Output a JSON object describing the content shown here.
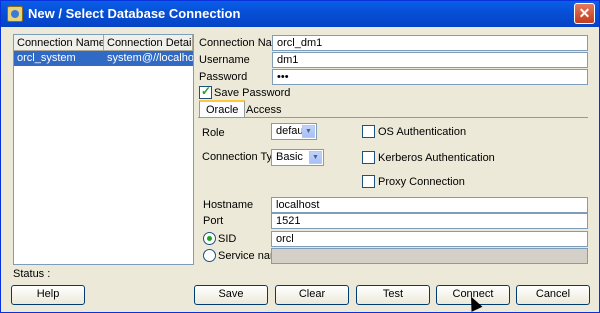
{
  "window": {
    "title": "New / Select Database Connection",
    "close_label": "✕"
  },
  "connections": {
    "columns": [
      "Connection Name",
      "Connection Details"
    ],
    "rows": [
      {
        "name": "orcl_system",
        "details": "system@//localhost..."
      }
    ]
  },
  "status": {
    "label": "Status :"
  },
  "form": {
    "connection_name": {
      "label": "Connection Name",
      "value": "orcl_dm1"
    },
    "username": {
      "label": "Username",
      "value": "dm1"
    },
    "password": {
      "label": "Password",
      "value": "•••"
    },
    "save_password": {
      "label": "Save Password",
      "checked": true
    }
  },
  "tabs": [
    {
      "label": "Oracle",
      "active": true
    },
    {
      "label": "Access",
      "active": false
    }
  ],
  "oracle": {
    "role": {
      "label": "Role",
      "value": "default"
    },
    "connection_type": {
      "label": "Connection Type",
      "value": "Basic"
    },
    "os_auth": {
      "label": "OS Authentication",
      "checked": false
    },
    "kerberos_auth": {
      "label": "Kerberos Authentication",
      "checked": false
    },
    "proxy": {
      "label": "Proxy Connection",
      "checked": false
    },
    "hostname": {
      "label": "Hostname",
      "value": "localhost"
    },
    "port": {
      "label": "Port",
      "value": "1521"
    },
    "sid": {
      "label": "SID",
      "value": "orcl",
      "selected": true
    },
    "service_name": {
      "label": "Service name",
      "value": "",
      "selected": false
    }
  },
  "buttons": {
    "help": "Help",
    "save": "Save",
    "clear": "Clear",
    "test": "Test",
    "connect": "Connect",
    "cancel": "Cancel"
  },
  "colors": {
    "titlebar": "#0543c4",
    "selection": "#316ac5",
    "dialog_bg": "#ece9d8"
  }
}
